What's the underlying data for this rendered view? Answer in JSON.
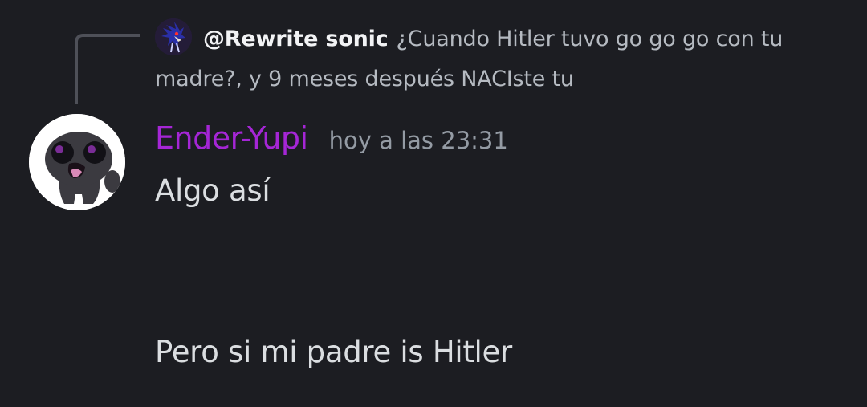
{
  "reply": {
    "author": "@Rewrite sonic",
    "text": "¿Cuando Hitler tuvo go go go con tu madre?, y 9 meses después NACIste tu"
  },
  "message": {
    "username": "Ender-Yupi",
    "timestamp": "hoy a las 23:31",
    "lines": [
      "Algo así",
      "Pero si mi padre is Hitler"
    ]
  },
  "colors": {
    "background": "#1c1d22",
    "username": "#a526d6",
    "timestamp": "#949ba4",
    "text": "#dbdee1",
    "reply_author": "#f2f3f5",
    "reply_text": "#b5bac1",
    "reply_spine": "#4e5058"
  },
  "icons": {
    "reply_avatar": "sonic-avatar-icon",
    "avatar": "shadow-creature-avatar-icon"
  }
}
